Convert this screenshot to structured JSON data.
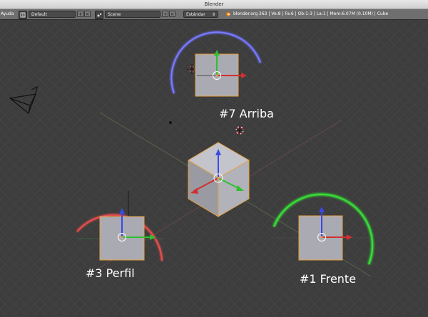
{
  "window": {
    "title": "Blender"
  },
  "header": {
    "menu": "Ayuda",
    "layout_icon": "screen-layout-icon",
    "layout_value": "Default",
    "scene_icon": "scene-icon",
    "scene_value": "Scene",
    "add_symbol": "+",
    "remove_symbol": "×",
    "engine_value": "Estándar",
    "engine_chevron": "⇕",
    "status": "blender.org 263 | Ve:8 | Fa:6 | Ob:1-3 | La:1 | Mem:6.07M (0.10M) | Cube"
  },
  "viewport": {
    "labels": {
      "top": "#7 Arriba",
      "side": "#3 Perfil",
      "front": "#1 Frente"
    }
  },
  "colors": {
    "background": "#3d3d3d",
    "grid": "#4a4a4a",
    "x_axis": "#d24040",
    "y_axis": "#3cbf3c",
    "z_axis": "#4a5ae0",
    "selection": "#e8a040",
    "cube_face": "#a8a8b0"
  }
}
